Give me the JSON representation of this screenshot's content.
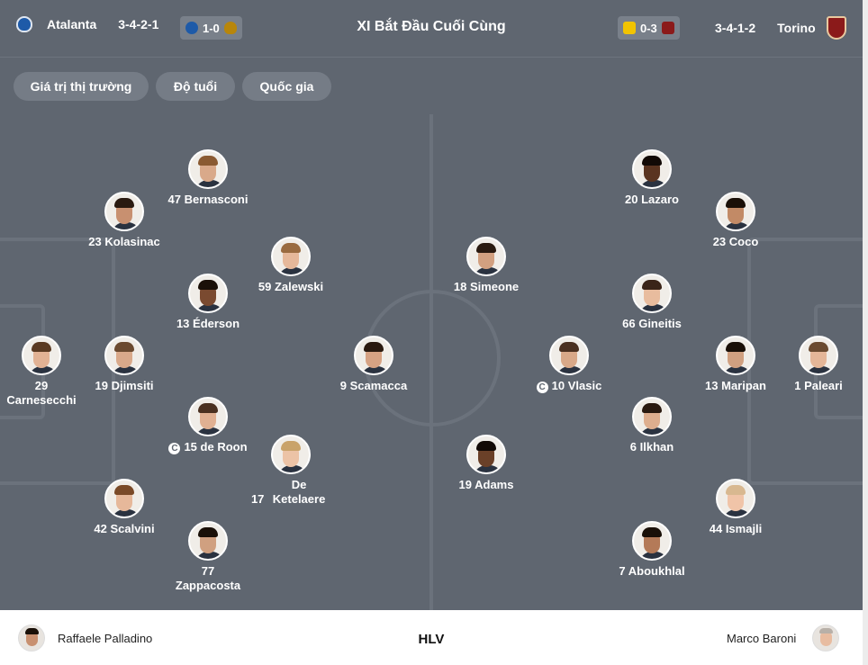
{
  "header": {
    "home_team": "Atalanta",
    "home_formation": "3-4-2-1",
    "home_last_result": "1-0",
    "title": "XI Bắt Đầu Cuối Cùng",
    "away_last_result": "0-3",
    "away_formation": "3-4-1-2",
    "away_team": "Torino"
  },
  "filters": [
    "Giá trị thị trường",
    "Độ tuổi",
    "Quốc gia"
  ],
  "colors": {
    "pitch": "#5f6670",
    "chip": "#757c86",
    "atalanta": "#1e5aa8",
    "torino": "#8b1a1a",
    "roma": "#b8860b",
    "verona": "#f2c400"
  },
  "home_players": [
    {
      "number": "47",
      "name": "Bernasconi"
    },
    {
      "number": "23",
      "name": "Kolasinac"
    },
    {
      "number": "59",
      "name": "Zalewski"
    },
    {
      "number": "13",
      "name": "Éderson"
    },
    {
      "number": "29",
      "name": "Carnesecchi"
    },
    {
      "number": "19",
      "name": "Djimsiti"
    },
    {
      "number": "9",
      "name": "Scamacca"
    },
    {
      "number": "15",
      "name": "de Roon"
    },
    {
      "number": "17",
      "name": "De Ketelaere"
    },
    {
      "number": "42",
      "name": "Scalvini"
    },
    {
      "number": "77",
      "name": "Zappacosta"
    }
  ],
  "away_players": [
    {
      "number": "20",
      "name": "Lazaro"
    },
    {
      "number": "23",
      "name": "Coco"
    },
    {
      "number": "18",
      "name": "Simeone"
    },
    {
      "number": "66",
      "name": "Gineitis"
    },
    {
      "number": "10",
      "name": "Vlasic"
    },
    {
      "number": "13",
      "name": "Maripan"
    },
    {
      "number": "1",
      "name": "Paleari"
    },
    {
      "number": "6",
      "name": "Ilkhan"
    },
    {
      "number": "19",
      "name": "Adams"
    },
    {
      "number": "44",
      "name": "Ismajli"
    },
    {
      "number": "7",
      "name": "Aboukhlal"
    }
  ],
  "captain_mark": "C",
  "coaches": {
    "home": "Raffaele Palladino",
    "label": "HLV",
    "away": "Marco Baroni"
  }
}
